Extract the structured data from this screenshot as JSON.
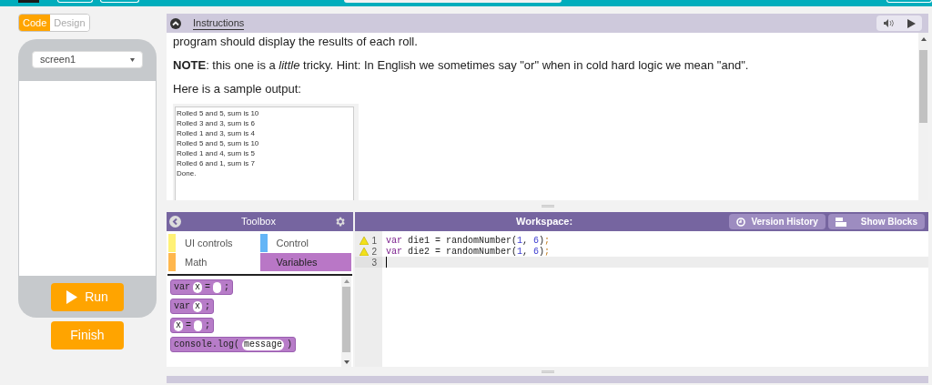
{
  "mode_toggle": [
    {
      "label": "Code",
      "selected": true
    },
    {
      "label": "Design",
      "selected": false
    }
  ],
  "screen_select": {
    "value": "screen1"
  },
  "run_button": "Run",
  "finish_button": "Finish",
  "instructions": {
    "title": "Instructions",
    "paragraphs": [
      "program should display the results of each roll.",
      "**NOTE**: this one is a *little* tricky. Hint: In English we sometimes say \"or\" when in cold hard logic we mean \"and\".",
      "Here is a sample output:"
    ],
    "sample_output": [
      "Rolled 5 and 5, sum is 10",
      "Rolled 3 and 3, sum is 6",
      "Rolled 1 and 3, sum is 4",
      "Rolled 5 and 5, sum is 10",
      "Rolled 1 and 4, sum is 5",
      "Rolled 6 and 1, sum is 7",
      "Done."
    ]
  },
  "toolbox": {
    "title": "Toolbox",
    "categories": [
      {
        "label": "UI controls",
        "color": "#fff176",
        "selected": false
      },
      {
        "label": "Control",
        "color": "#64b5f6",
        "selected": false
      },
      {
        "label": "Math",
        "color": "#ffb74d",
        "selected": false
      },
      {
        "label": "Variables",
        "color": "#b977c6",
        "selected": true
      }
    ],
    "blocks": [
      {
        "parts": [
          {
            "kind": "text",
            "text": "var"
          },
          {
            "kind": "slot",
            "text": "x"
          },
          {
            "kind": "text",
            "text": "="
          },
          {
            "kind": "slot"
          },
          {
            "kind": "text",
            "text": ";"
          }
        ]
      },
      {
        "parts": [
          {
            "kind": "text",
            "text": "var"
          },
          {
            "kind": "slot",
            "text": "x"
          },
          {
            "kind": "text",
            "text": ";"
          }
        ]
      },
      {
        "parts": [
          {
            "kind": "slot",
            "text": "x"
          },
          {
            "kind": "text",
            "text": "="
          },
          {
            "kind": "slot"
          },
          {
            "kind": "text",
            "text": ";"
          }
        ]
      },
      {
        "parts": [
          {
            "kind": "text",
            "text": "console.log("
          },
          {
            "kind": "slot",
            "text": "message"
          },
          {
            "kind": "text",
            "text": ")"
          }
        ]
      }
    ]
  },
  "workspace": {
    "title": "Workspace:",
    "buttons": [
      {
        "kind": "history",
        "label": "Version History"
      },
      {
        "kind": "blocks",
        "label": "Show Blocks"
      }
    ],
    "lines": [
      {
        "number": "1",
        "warning": true,
        "active": false,
        "tokens": [
          {
            "kind": "keyword",
            "text": "var"
          },
          {
            "kind": "plain",
            "text": " die1 = randomNumber("
          },
          {
            "kind": "number",
            "text": "1"
          },
          {
            "kind": "plain",
            "text": ", "
          },
          {
            "kind": "number",
            "text": "6"
          },
          {
            "kind": "plain",
            "text": ")"
          },
          {
            "kind": "punct",
            "text": ";"
          }
        ]
      },
      {
        "number": "2",
        "warning": true,
        "active": false,
        "tokens": [
          {
            "kind": "keyword",
            "text": "var"
          },
          {
            "kind": "plain",
            "text": " die2 = randomNumber("
          },
          {
            "kind": "number",
            "text": "1"
          },
          {
            "kind": "plain",
            "text": ", "
          },
          {
            "kind": "number",
            "text": "6"
          },
          {
            "kind": "plain",
            "text": ")"
          },
          {
            "kind": "punct",
            "text": ";"
          }
        ]
      },
      {
        "number": "3",
        "warning": false,
        "active": true
      }
    ]
  }
}
